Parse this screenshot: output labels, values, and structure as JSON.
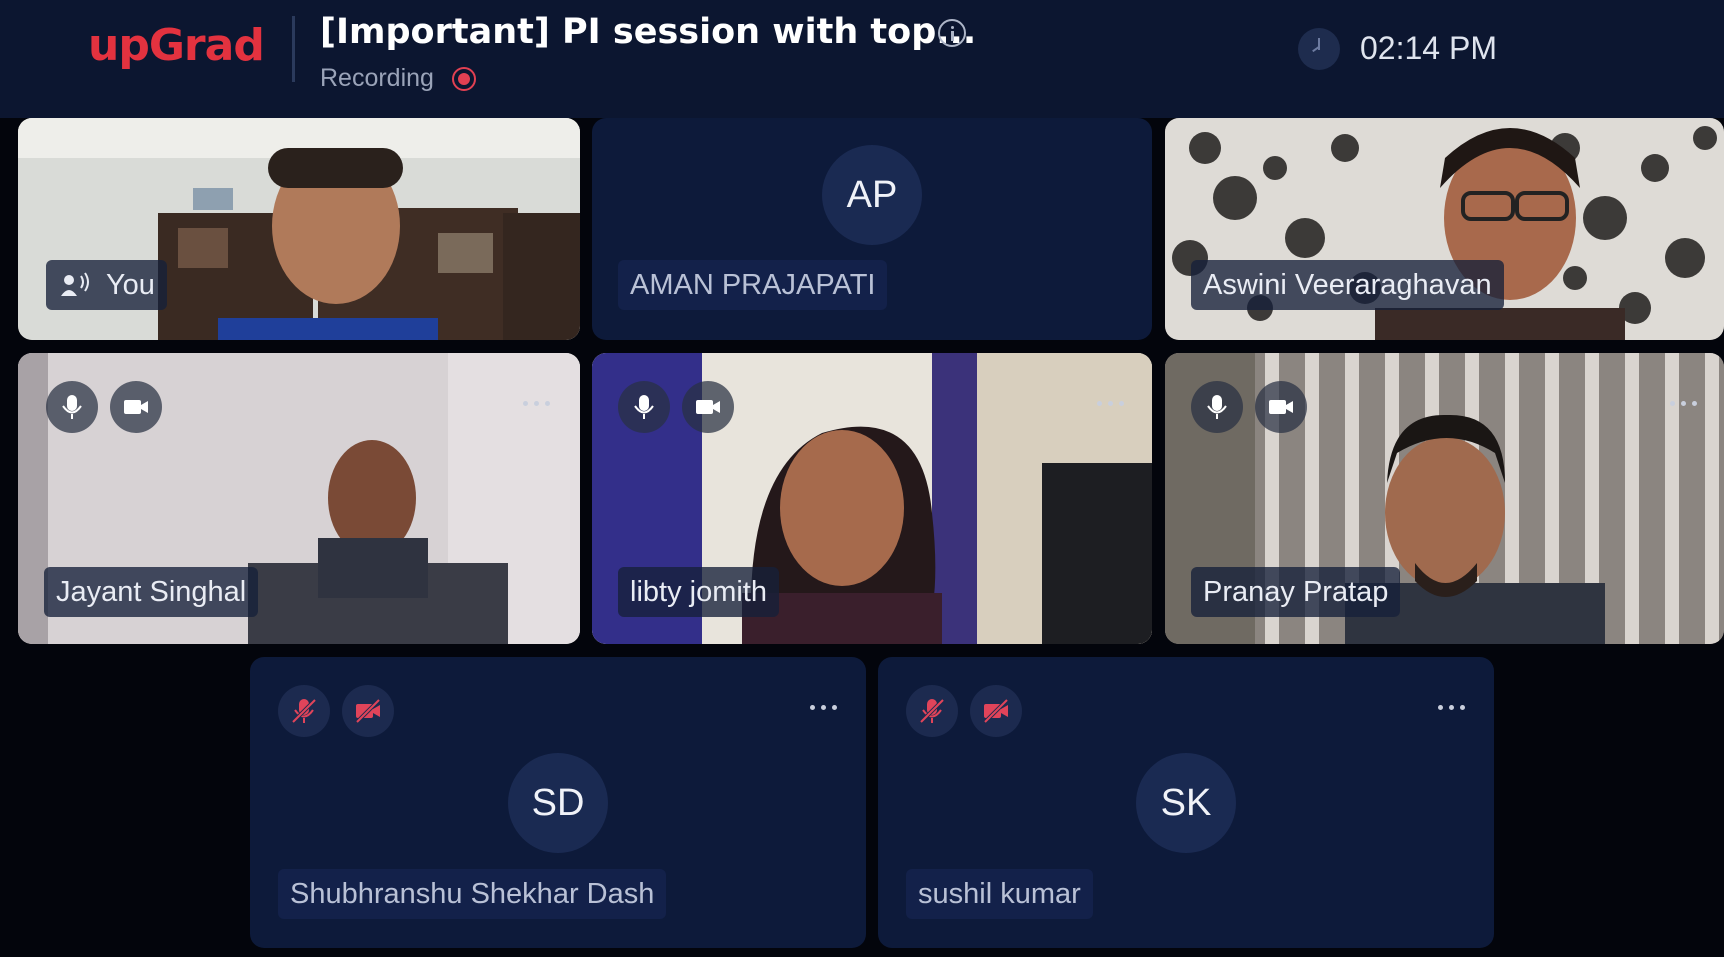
{
  "header": {
    "logo": "upGrad",
    "title": "[Important] PI session with top...",
    "recording_label": "Recording",
    "time": "02:14 PM"
  },
  "participants": [
    {
      "name": "You",
      "initials": "",
      "video": true,
      "speaking": true
    },
    {
      "name": "AMAN PRAJAPATI",
      "initials": "AP",
      "video": false
    },
    {
      "name": "Aswini Veeraraghavan",
      "initials": "",
      "video": true
    },
    {
      "name": "Jayant Singhal",
      "initials": "",
      "video": true,
      "mic_on": true,
      "camera_on": true
    },
    {
      "name": "libty jomith",
      "initials": "",
      "video": true,
      "mic_on": true,
      "camera_on": true
    },
    {
      "name": "Pranay Pratap",
      "initials": "",
      "video": true,
      "mic_on": true,
      "camera_on": true
    },
    {
      "name": "Shubhranshu Shekhar Dash",
      "initials": "SD",
      "video": false,
      "mic_on": false,
      "camera_on": false
    },
    {
      "name": "sushil kumar",
      "initials": "SK",
      "video": false,
      "mic_on": false,
      "camera_on": false
    }
  ],
  "colors": {
    "brand": "#e3323f",
    "header_bg": "#0c1630",
    "tile_bg": "#0d1a3a",
    "muted_icon": "#e0445a"
  },
  "icons": [
    "info-icon",
    "recording-icon",
    "clock-icon",
    "speaker-icon",
    "mic-icon",
    "camera-icon",
    "mic-off-icon",
    "camera-off-icon",
    "more-options-icon"
  ]
}
